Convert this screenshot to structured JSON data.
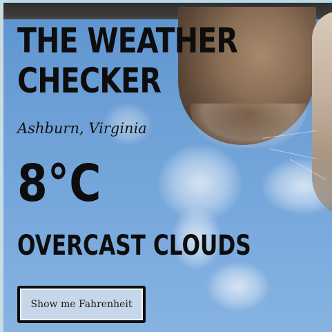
{
  "app": {
    "title_line1": "THE WEATHER",
    "title_line2": "CHECKER"
  },
  "weather": {
    "location": "Ashburn, Virginia",
    "temperature": "8°C",
    "condition": "OVERCAST CLOUDS"
  },
  "controls": {
    "unit_toggle_label": "Show me Fahrenheit"
  },
  "background": {
    "description_icon": "cat-paw-sky-photo",
    "sky_color": "#6da0d6",
    "text_color": "#0d0d0d"
  }
}
